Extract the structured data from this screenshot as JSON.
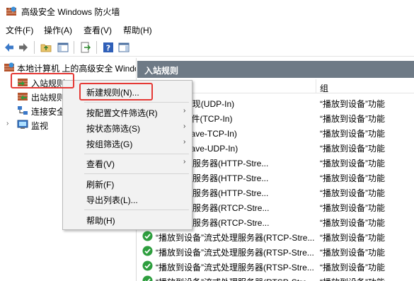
{
  "window": {
    "title": "高级安全 Windows 防火墙",
    "icon": "firewall-icon"
  },
  "menu": [
    "文件(F)",
    "操作(A)",
    "查看(V)",
    "帮助(H)"
  ],
  "toolbar": [
    "back-icon",
    "forward-icon",
    "up-folder-icon",
    "show-hide-console-tree-icon",
    "export-icon",
    "help-icon",
    "show-action-pane-icon"
  ],
  "tree": {
    "root": "本地计算机 上的高级安全 Windows",
    "items": [
      "入站规则",
      "出站规则",
      "连接安全规则",
      "监视"
    ],
    "visible_text": [
      "入站规则",
      "出站规则",
      "连接安全",
      "监视"
    ]
  },
  "pane": {
    "header": "入站规则",
    "col_group": "组",
    "rows": [
      {
        "name": "“SSDP 发现(UDP-In)",
        "group": "“播放到设备”功能"
      },
      {
        "name": "“UPnP 事件(TCP-In)",
        "group": "“播放到设备”功能"
      },
      {
        "name": "”功能(qWave-TCP-In)",
        "group": "“播放到设备”功能"
      },
      {
        "name": "”功能(qWave-UDP-In)",
        "group": "“播放到设备”功能"
      },
      {
        "name": "“流式处理服务器(HTTP-Stre...",
        "group": "“播放到设备”功能"
      },
      {
        "name": "“流式处理服务器(HTTP-Stre...",
        "group": "“播放到设备”功能"
      },
      {
        "name": "“流式处理服务器(HTTP-Stre...",
        "group": "“播放到设备”功能"
      },
      {
        "name": "“流式处理服务器(RTCP-Stre...",
        "group": "“播放到设备”功能"
      },
      {
        "name": "“流式处理服务器(RTCP-Stre...",
        "group": "“播放到设备”功能"
      },
      {
        "name": "“播放到设备”流式处理服务器(RTCP-Stre...",
        "group": "“播放到设备”功能"
      },
      {
        "name": "“播放到设备”流式处理服务器(RTSP-Stre...",
        "group": "“播放到设备”功能"
      },
      {
        "name": "“播放到设备”流式处理服务器(RTSP-Stre...",
        "group": "“播放到设备”功能"
      },
      {
        "name": "“播放到设备”流式处理服务器(RTSP-Stre...",
        "group": "“播放到设备”功能"
      }
    ]
  },
  "context_menu": {
    "items": [
      {
        "label": "新建规则(N)...",
        "submenu": false
      },
      {
        "label": "按配置文件筛选(R)",
        "submenu": true
      },
      {
        "label": "按状态筛选(S)",
        "submenu": true
      },
      {
        "label": "按组筛选(G)",
        "submenu": true
      },
      {
        "label": "查看(V)",
        "submenu": true
      },
      {
        "label": "刷新(F)",
        "submenu": false
      },
      {
        "label": "导出列表(L)...",
        "submenu": false
      },
      {
        "label": "帮助(H)",
        "submenu": false
      }
    ]
  },
  "colors": {
    "highlight": "#e53935",
    "header_bg": "#6e7a86",
    "check_green": "#2e9e3e"
  }
}
